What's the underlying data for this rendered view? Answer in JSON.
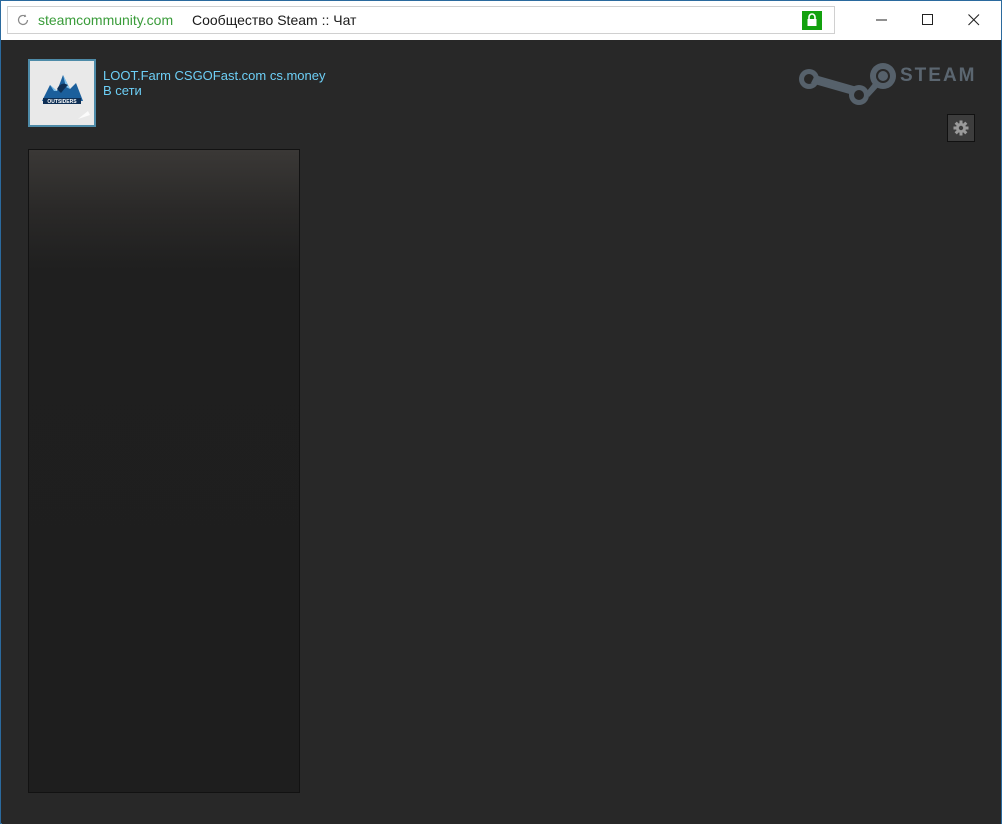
{
  "browser": {
    "url": "steamcommunity.com",
    "page_title": "Сообщество Steam :: Чат",
    "secure": true
  },
  "user": {
    "name": "LOOT.Farm CSGOFast.com cs.money",
    "status": "В сети",
    "avatar_text": "OUTSIDERS"
  },
  "brand": {
    "wordmark": "STEAM"
  },
  "colors": {
    "accent": "#6dcff6",
    "background": "#282828",
    "url_green": "#3a9c3a",
    "lock_green": "#13a10e",
    "frame_blue": "#2b6a9e"
  },
  "icons": [
    "reload-icon",
    "lock-icon",
    "minimize-icon",
    "maximize-icon",
    "close-icon",
    "steam-logo-icon",
    "gear-icon"
  ]
}
